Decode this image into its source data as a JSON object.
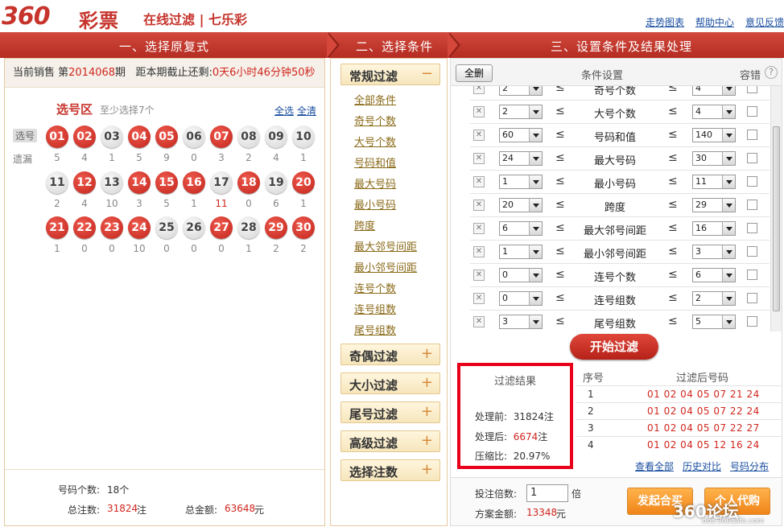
{
  "header": {
    "logo_num": "360",
    "logo_text": "彩票",
    "app_title": "在线过滤 | 七乐彩",
    "links": [
      "走势图表",
      "帮助中心",
      "意见反馈"
    ]
  },
  "steps": [
    "一、选择原复式",
    "二、选择条件",
    "三、设置条件及结果处理"
  ],
  "sale": {
    "prefix": "当前销售 第",
    "issue": "2014068",
    "suffix": "期",
    "countdown_label": "距本期截止还剩:",
    "countdown": "0天6小时46分钟50秒"
  },
  "pick": {
    "title": "选号区",
    "hint": "至少选择7个",
    "select_all": "全选",
    "clear_all": "全清",
    "label_pick": "选号",
    "label_miss": "遗漏",
    "balls": [
      {
        "n": "01",
        "on": true,
        "miss": "5"
      },
      {
        "n": "02",
        "on": true,
        "miss": "4"
      },
      {
        "n": "03",
        "on": false,
        "miss": "1"
      },
      {
        "n": "04",
        "on": true,
        "miss": "5"
      },
      {
        "n": "05",
        "on": true,
        "miss": "9"
      },
      {
        "n": "06",
        "on": false,
        "miss": "0"
      },
      {
        "n": "07",
        "on": true,
        "miss": "3"
      },
      {
        "n": "08",
        "on": false,
        "miss": "2"
      },
      {
        "n": "09",
        "on": false,
        "miss": "4"
      },
      {
        "n": "10",
        "on": false,
        "miss": "1"
      },
      {
        "n": "11",
        "on": false,
        "miss": "2"
      },
      {
        "n": "12",
        "on": true,
        "miss": "4"
      },
      {
        "n": "13",
        "on": false,
        "miss": "10"
      },
      {
        "n": "14",
        "on": true,
        "miss": "3"
      },
      {
        "n": "15",
        "on": true,
        "miss": "5"
      },
      {
        "n": "16",
        "on": true,
        "miss": "1"
      },
      {
        "n": "17",
        "on": false,
        "miss": "11"
      },
      {
        "n": "18",
        "on": true,
        "miss": "0"
      },
      {
        "n": "19",
        "on": false,
        "miss": "6"
      },
      {
        "n": "20",
        "on": true,
        "miss": "1"
      },
      {
        "n": "21",
        "on": true,
        "miss": "1"
      },
      {
        "n": "22",
        "on": true,
        "miss": "0"
      },
      {
        "n": "23",
        "on": true,
        "miss": "0"
      },
      {
        "n": "24",
        "on": true,
        "miss": "10"
      },
      {
        "n": "25",
        "on": false,
        "miss": "0"
      },
      {
        "n": "26",
        "on": false,
        "miss": "0"
      },
      {
        "n": "27",
        "on": true,
        "miss": "0"
      },
      {
        "n": "28",
        "on": false,
        "miss": "1"
      },
      {
        "n": "29",
        "on": true,
        "miss": "2"
      },
      {
        "n": "30",
        "on": true,
        "miss": "2"
      }
    ],
    "hot_miss": "11"
  },
  "left_footer": {
    "count_label": "号码个数:",
    "count_value": "18个",
    "total_label": "总注数:",
    "total_value": "31824",
    "total_unit": "注",
    "amount_label": "总金额:",
    "amount_value": "63648",
    "amount_unit": "元"
  },
  "filters": {
    "groups": [
      {
        "title": "常规过滤",
        "sign": "−"
      },
      {
        "title": "奇偶过滤",
        "sign": "+"
      },
      {
        "title": "大小过滤",
        "sign": "+"
      },
      {
        "title": "尾号过滤",
        "sign": "+"
      },
      {
        "title": "高级过滤",
        "sign": "+"
      },
      {
        "title": "选择注数",
        "sign": "+"
      }
    ],
    "options": [
      "全部条件",
      "奇号个数",
      "大号个数",
      "号码和值",
      "最大号码",
      "最小号码",
      "跨度",
      "最大邻号间距",
      "最小邻号间距",
      "连号个数",
      "连号组数",
      "尾号组数"
    ]
  },
  "conditions": {
    "delete_all": "全删",
    "title": "条件设置",
    "tolerance": "容错",
    "help": "?",
    "x": "✕",
    "le": "≤",
    "rows": [
      {
        "min": "2",
        "name": "奇号个数",
        "max": "4"
      },
      {
        "min": "2",
        "name": "大号个数",
        "max": "4"
      },
      {
        "min": "60",
        "name": "号码和值",
        "max": "140"
      },
      {
        "min": "24",
        "name": "最大号码",
        "max": "30"
      },
      {
        "min": "1",
        "name": "最小号码",
        "max": "11"
      },
      {
        "min": "20",
        "name": "跨度",
        "max": "29"
      },
      {
        "min": "6",
        "name": "最大邻号间距",
        "max": "16"
      },
      {
        "min": "1",
        "name": "最小邻号间距",
        "max": "3"
      },
      {
        "min": "0",
        "name": "连号个数",
        "max": "6"
      },
      {
        "min": "0",
        "name": "连号组数",
        "max": "2"
      },
      {
        "min": "3",
        "name": "尾号组数",
        "max": "5"
      }
    ],
    "start_button": "开始过滤"
  },
  "result": {
    "title": "过滤结果",
    "before_label": "处理前:",
    "before_value": "31824注",
    "after_label": "处理后:",
    "after_value": "6674",
    "after_unit": "注",
    "ratio_label": "压缩比:",
    "ratio_value": "20.97%",
    "col_index": "序号",
    "col_numbers": "过滤后号码",
    "rows": [
      {
        "i": "1",
        "v": "01 02 04 05 07 21 24"
      },
      {
        "i": "2",
        "v": "01 02 04 05 07 22 24"
      },
      {
        "i": "3",
        "v": "01 02 04 05 07 22 27"
      },
      {
        "i": "4",
        "v": "01 02 04 05 12 16 24"
      }
    ],
    "links": [
      "查看全部",
      "历史对比",
      "号码分布"
    ]
  },
  "order": {
    "mult_label": "投注倍数:",
    "mult_value": "1",
    "mult_unit": "倍",
    "amount_label": "方案金额:",
    "amount_value": "13348",
    "amount_unit": "元",
    "group_buy": "发起合买",
    "proxy_buy": "个人代购"
  },
  "watermark": {
    "text": "360论坛",
    "url": "bbs.360safe.com"
  }
}
